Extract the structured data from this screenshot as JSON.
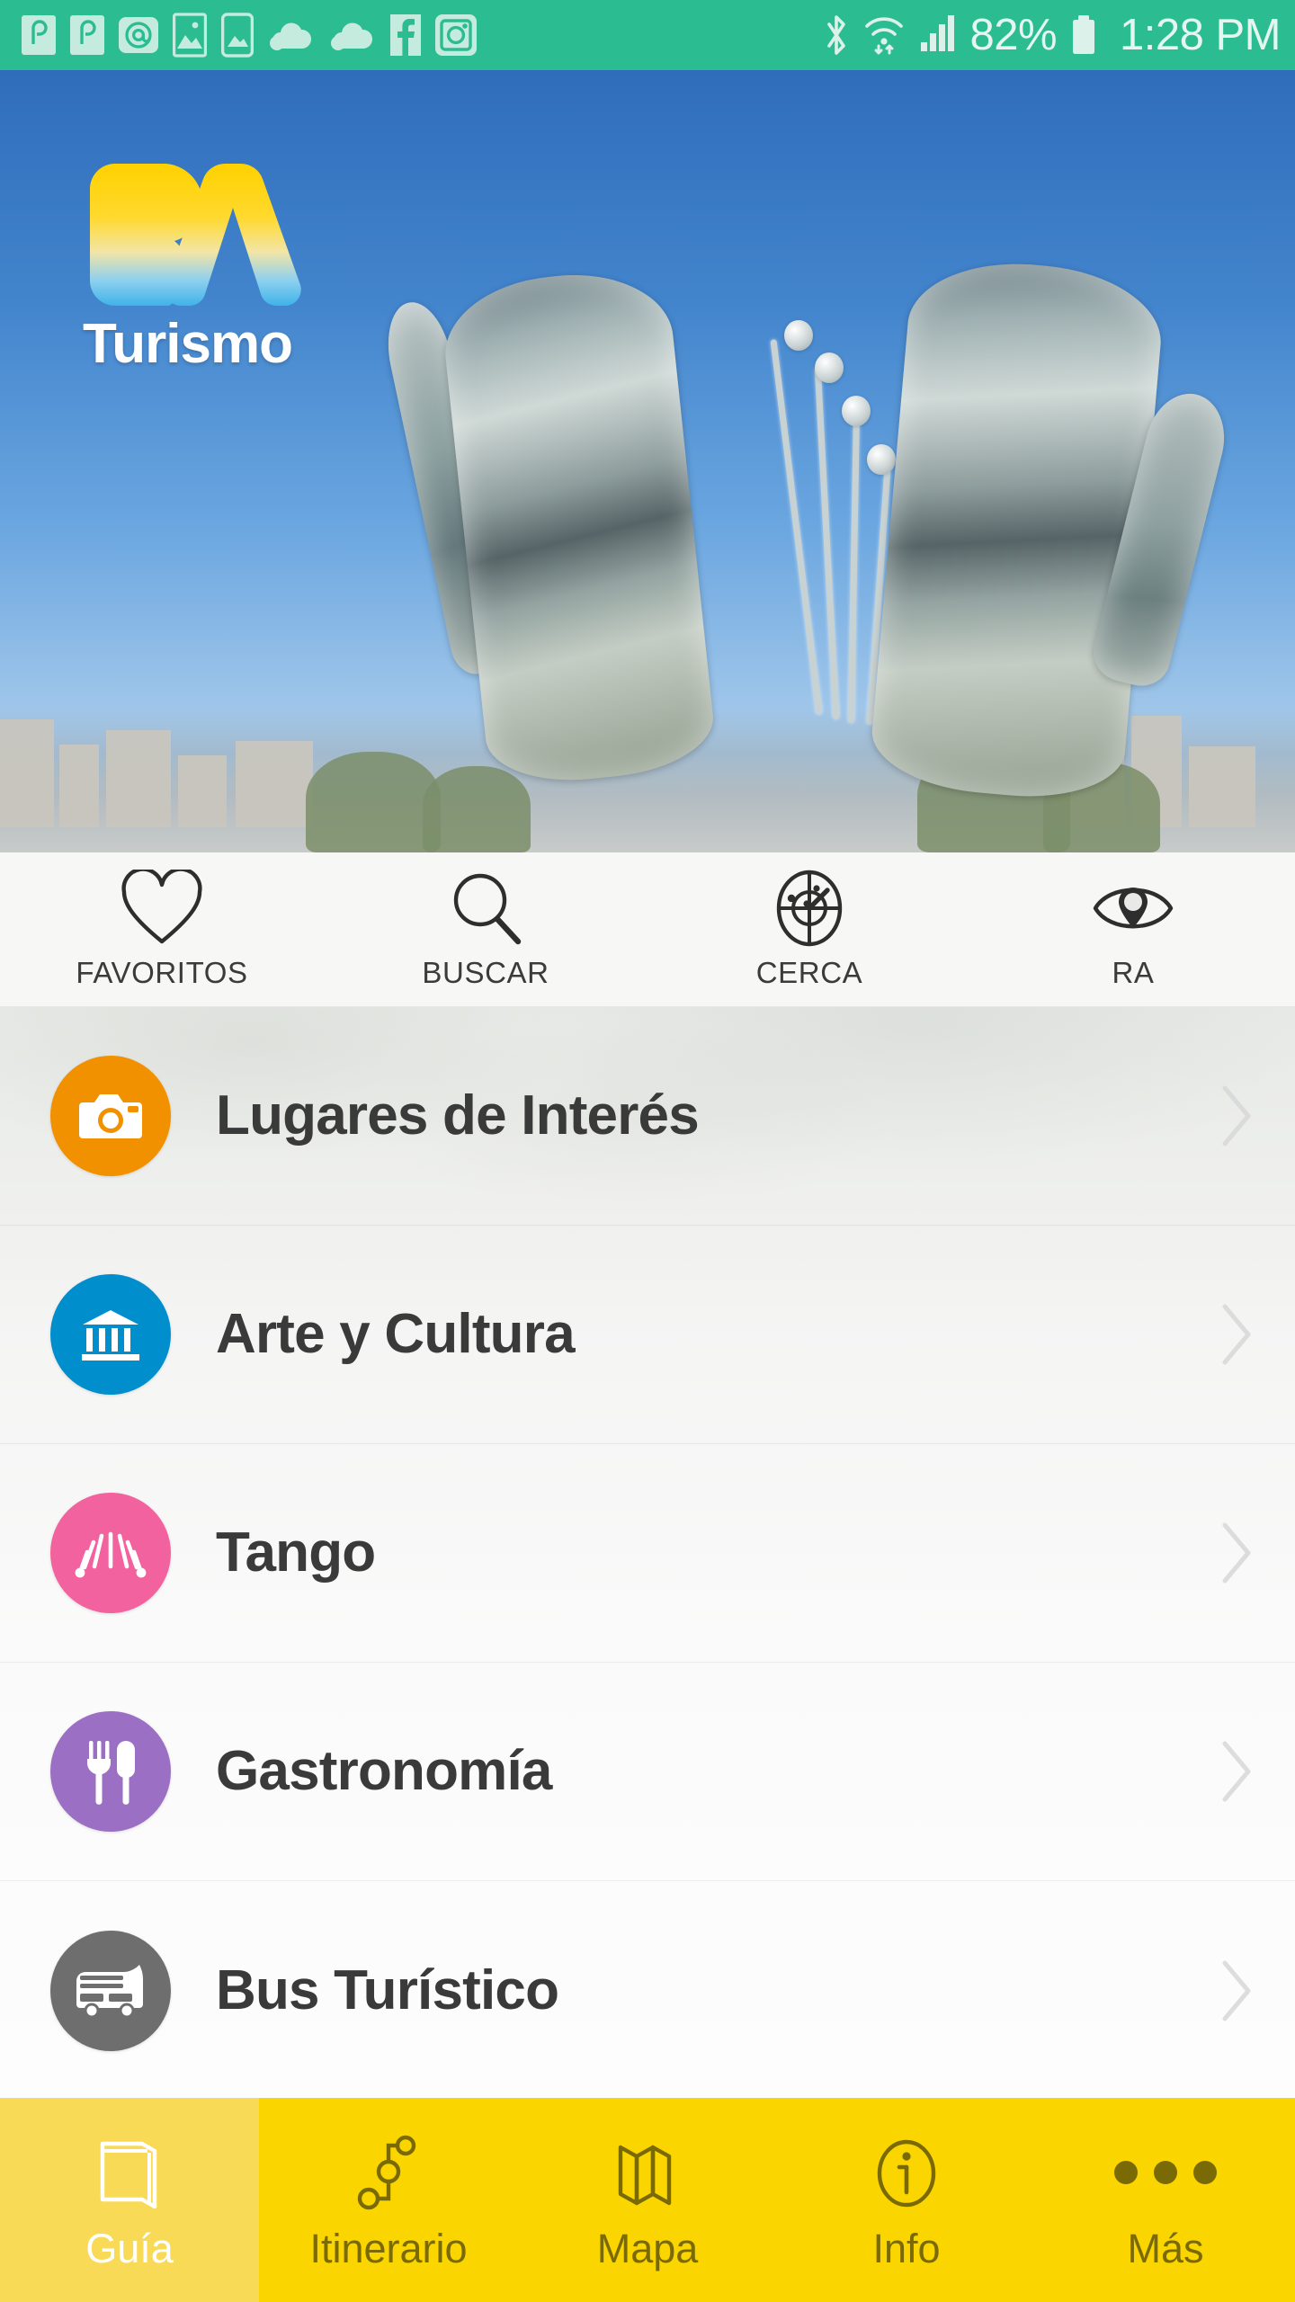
{
  "status_bar": {
    "background_color": "#2bbd91",
    "left_icons": [
      "app-notification-icon-1",
      "app-notification-icon-2",
      "email-at-icon",
      "gallery-image-icon",
      "phone-image-icon",
      "cloud-sync-icon-1",
      "cloud-sync-icon-2",
      "facebook-icon",
      "instagram-icon"
    ],
    "right_icons": [
      "bluetooth-icon",
      "wifi-icon",
      "cellular-signal-icon",
      "battery-icon"
    ],
    "battery_percent": "82%",
    "time": "1:28 PM"
  },
  "hero": {
    "logo_mark": "BA",
    "logo_word": "Turismo",
    "logo_gradient_from": "#ffd100",
    "logo_gradient_to": "#3fb3e8",
    "photo_subject": "floralis-generica-sculpture"
  },
  "action_bar": {
    "items": [
      {
        "label": "FAVORITOS",
        "icon": "heart-icon"
      },
      {
        "label": "BUSCAR",
        "icon": "search-icon"
      },
      {
        "label": "CERCA",
        "icon": "radar-icon"
      },
      {
        "label": "RA",
        "icon": "eye-pin-icon"
      }
    ]
  },
  "categories": {
    "items": [
      {
        "label": "Lugares de Interés",
        "icon": "camera-icon",
        "color": "#f29100"
      },
      {
        "label": "Arte y Cultura",
        "icon": "museum-icon",
        "color": "#008ecd"
      },
      {
        "label": "Tango",
        "icon": "bandoneon-icon",
        "color": "#f2629f"
      },
      {
        "label": "Gastronomía",
        "icon": "fork-knife-icon",
        "color": "#9b6fc4"
      },
      {
        "label": "Bus Turístico",
        "icon": "bus-icon",
        "color": "#6e6e6e"
      }
    ],
    "chevron_icon": "chevron-right-icon"
  },
  "bottom_nav": {
    "active_background": "#f9da57",
    "inactive_background": "#fbd500",
    "items": [
      {
        "label": "Guía",
        "icon": "book-icon",
        "active": true
      },
      {
        "label": "Itinerario",
        "icon": "route-icon",
        "active": false
      },
      {
        "label": "Mapa",
        "icon": "map-icon",
        "active": false
      },
      {
        "label": "Info",
        "icon": "info-circle-icon",
        "active": false
      },
      {
        "label": "Más",
        "icon": "more-dots-icon",
        "active": false
      }
    ]
  }
}
